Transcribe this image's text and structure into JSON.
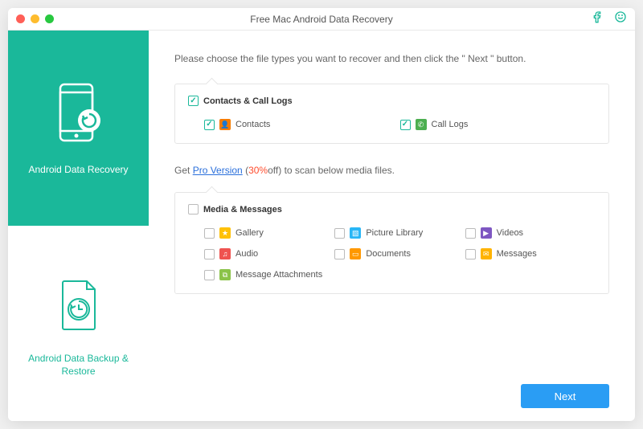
{
  "window": {
    "title": "Free Mac Android Data Recovery"
  },
  "sidebar": {
    "items": [
      {
        "label": "Android Data Recovery"
      },
      {
        "label": "Android Data Backup & Restore"
      }
    ]
  },
  "main": {
    "instruction": "Please choose the file types you want to recover and then click the \" Next \" button.",
    "group1": {
      "title": "Contacts & Call Logs",
      "items": [
        {
          "label": "Contacts",
          "icon_color": "#f57c00",
          "glyph": "👤"
        },
        {
          "label": "Call Logs",
          "icon_color": "#4caf50",
          "glyph": "✆"
        }
      ]
    },
    "promo": {
      "prefix": "Get ",
      "link": "Pro Version",
      "discount": "30%",
      "suffix_off": "off",
      "suffix": ") to scan below media files."
    },
    "group2": {
      "title": "Media & Messages",
      "items": [
        {
          "label": "Gallery",
          "icon_color": "#ffc107",
          "glyph": "★"
        },
        {
          "label": "Picture Library",
          "icon_color": "#29b6f6",
          "glyph": "▧"
        },
        {
          "label": "Videos",
          "icon_color": "#7e57c2",
          "glyph": "▶"
        },
        {
          "label": "Audio",
          "icon_color": "#ef5350",
          "glyph": "♫"
        },
        {
          "label": "Documents",
          "icon_color": "#ff9800",
          "glyph": "▭"
        },
        {
          "label": "Messages",
          "icon_color": "#ffb300",
          "glyph": "✉"
        },
        {
          "label": "Message Attachments",
          "icon_color": "#8bc34a",
          "glyph": "⧉"
        }
      ]
    }
  },
  "footer": {
    "next": "Next"
  }
}
